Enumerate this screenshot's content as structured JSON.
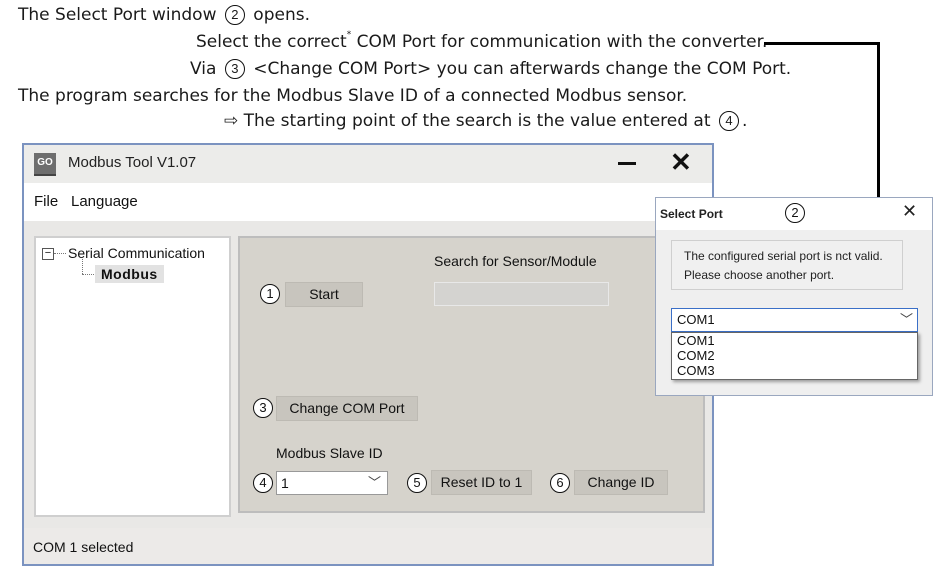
{
  "doc": {
    "line1_prefix": "The Select Port window",
    "line1_num": "2",
    "line1_suffix": "opens.",
    "line2_a": "Select the correct",
    "line2_sup": "*",
    "line2_b": " COM Port for communication with the converter.",
    "line3_prefix": "Via",
    "line3_num": "3",
    "line3_suffix": "<Change COM Port> you can afterwards change the COM Port.",
    "line4": "The program searches for the Modbus Slave ID of a connected Modbus sensor.",
    "line5_prefix": "⇨ The starting point of the search is the value entered at",
    "line5_num": "4",
    "line5_suffix": "."
  },
  "app": {
    "logo": "GO",
    "title": "Modbus Tool V1.07",
    "menu": [
      "File",
      "Language"
    ],
    "tree": {
      "root": "Serial Communication",
      "toggle": "−",
      "child": "Modbus"
    },
    "panel": {
      "start_num": "1",
      "start_label": "Start",
      "search_label": "Search for Sensor/Module",
      "search_value": "",
      "change_num": "3",
      "change_label": "Change COM Port",
      "slave_label": "Modbus Slave ID",
      "slave_num": "4",
      "slave_value": "1",
      "reset_num": "5",
      "reset_label": "Reset ID to 1",
      "changeid_num": "6",
      "changeid_label": "Change ID"
    },
    "status": "COM 1 selected"
  },
  "dialog": {
    "title": "Select Port",
    "title_num": "2",
    "message_line1": "The configured serial port is nct valid.",
    "message_line2": "Please choose another port.",
    "selected": "COM1",
    "options": [
      "COM1",
      "COM2",
      "COM3"
    ]
  },
  "icons": {
    "close": "close-icon",
    "minimize": "minimize-icon",
    "chevron": "chevron-down-icon"
  },
  "colors": {
    "window_border": "#7b93c0",
    "panel_bg": "#d6d3cc",
    "dialog_focus": "#3a6fc7"
  }
}
